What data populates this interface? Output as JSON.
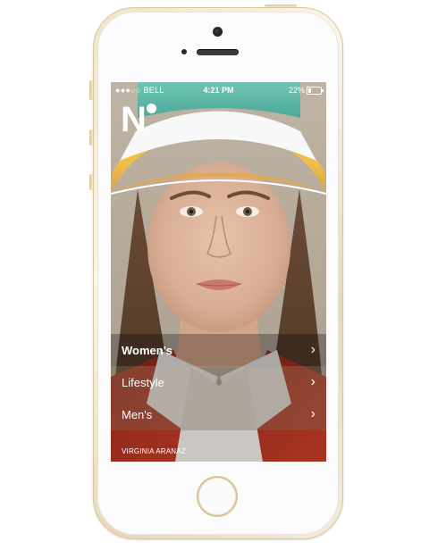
{
  "status_bar": {
    "carrier": "●●●○○ BELL",
    "time": "4:21 PM",
    "battery": "22%"
  },
  "app": {
    "logo": "N"
  },
  "menu": {
    "items": [
      {
        "label": "Women's"
      },
      {
        "label": "Lifestyle"
      },
      {
        "label": "Men's"
      }
    ],
    "chevron": "›"
  },
  "photo_credit": "VIRGINIA ARANAZ"
}
